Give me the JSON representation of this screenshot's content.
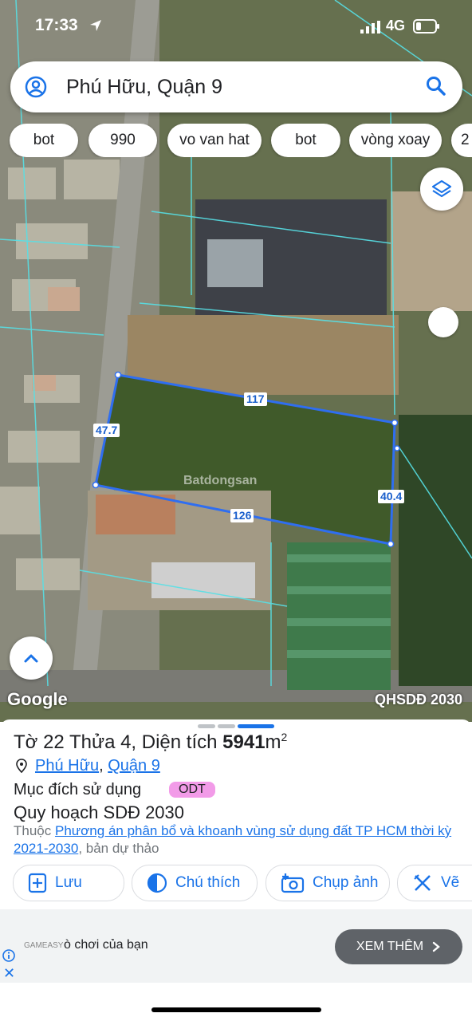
{
  "status_bar": {
    "time": "17:33",
    "network": "4G"
  },
  "search": {
    "query": "Phú Hữu, Quận 9"
  },
  "chips": [
    "bot",
    "990",
    "vo van hat",
    "bot",
    "vòng xoay",
    "2"
  ],
  "map": {
    "attribution": "Google",
    "layer_label": "QHSDĐ 2030",
    "watermark": "Batdongsan",
    "plot_dimensions": {
      "top": "117",
      "left": "47.7",
      "right": "40.4",
      "bottom": "126"
    }
  },
  "sheet": {
    "title_prefix": "Tờ 22 Thửa 4, Diện tích ",
    "area": "5941",
    "area_unit": "m",
    "area_sup": "2",
    "ward_link": "Phú Hữu",
    "district_link": "Quận 9",
    "purpose_label": "Mục đích sử dụng",
    "purpose_badge": "ODT",
    "plan_title": "Quy hoạch SDĐ 2030",
    "desc_prefix": "Thuộc ",
    "desc_link": "Phương án phân bổ và khoanh vùng sử dụng đất TP HCM thời kỳ 2021-2030",
    "desc_suffix": ", bản dự thảo",
    "actions": [
      "Lưu",
      "Chú thích",
      "Chụp ảnh",
      "Vẽ"
    ]
  },
  "ad": {
    "brand": "GAMEASY",
    "text": "ò chơi của bạn",
    "cta": "XEM THÊM"
  }
}
